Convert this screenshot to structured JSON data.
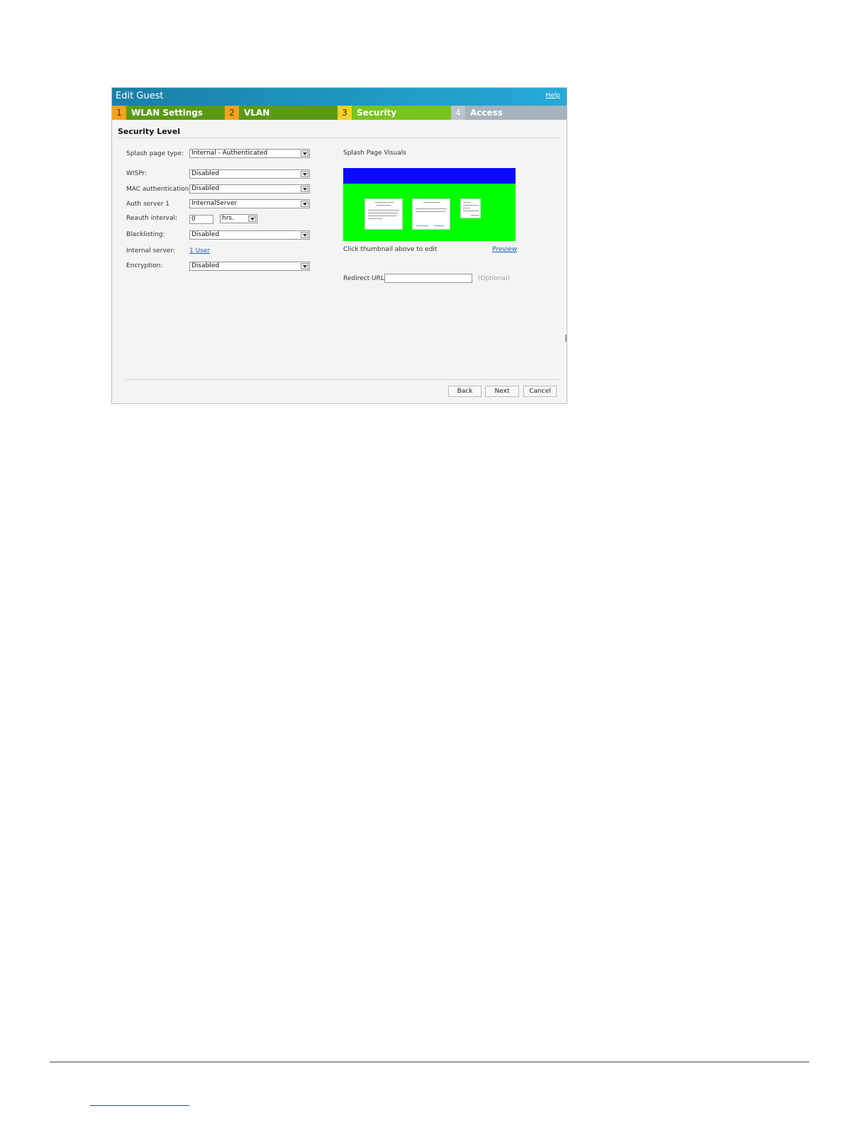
{
  "dialog": {
    "title": "Edit Guest",
    "help_label": "Help"
  },
  "steps": [
    {
      "number": "1",
      "label": "WLAN Settings"
    },
    {
      "number": "2",
      "label": "VLAN"
    },
    {
      "number": "3",
      "label": "Security"
    },
    {
      "number": "4",
      "label": "Access"
    }
  ],
  "section": {
    "title": "Security Level"
  },
  "fields": {
    "splash_page_type": {
      "label": "Splash page type:",
      "value": "Internal - Authenticated"
    },
    "waispr": {
      "label": "WISPr:",
      "value": "Disabled"
    },
    "mac_auth": {
      "label": "MAC authentication:",
      "value": "Disabled"
    },
    "auth_server": {
      "label": "Auth server 1",
      "value": "InternalServer"
    },
    "reauth": {
      "label": "Reauth interval:",
      "value": "0",
      "unit": "hrs."
    },
    "blacklisting": {
      "label": "Blacklisting:",
      "value": "Disabled"
    },
    "internal_server": {
      "label": "Internal server:",
      "link": "1 User"
    },
    "encryption": {
      "label": "Encryption:",
      "value": "Disabled"
    }
  },
  "visuals": {
    "label": "Splash Page Visuals",
    "caption": "Click thumbnail above to edit",
    "preview_label": "Preview",
    "banner_color": "#0a0aff",
    "background_color": "#00ff00"
  },
  "redirect": {
    "label": "Redirect URL:",
    "value": "",
    "optional_label": "(Optional)"
  },
  "buttons": {
    "back": "Back",
    "next": "Next",
    "cancel": "Cancel"
  }
}
